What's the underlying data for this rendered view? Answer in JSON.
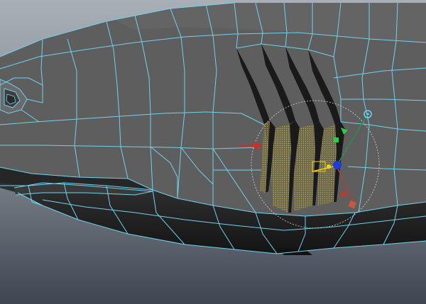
{
  "app": {
    "viewport_label": ""
  },
  "colors": {
    "background_top": "#a8aeb5",
    "background_bottom": "#3d4450",
    "mesh_face": "#5c5c5c",
    "mesh_face_dark": "#222222",
    "wireframe": "#6ed3f0",
    "selection_faces": "#c9b04a",
    "arrow": "#c8302a",
    "gizmo_x": "#c0392b",
    "gizmo_y": "#2ecc40",
    "gizmo_z": "#1f3bd6",
    "gizmo_center": "#f2d21b",
    "soft_select_circle": "#cfcfcf"
  },
  "tool": {
    "name": "move-tool",
    "mode": "soft-select"
  },
  "icons": [
    "toolbar-button-icon",
    "move-manipulator-icon",
    "indicator-arrow-icon"
  ]
}
